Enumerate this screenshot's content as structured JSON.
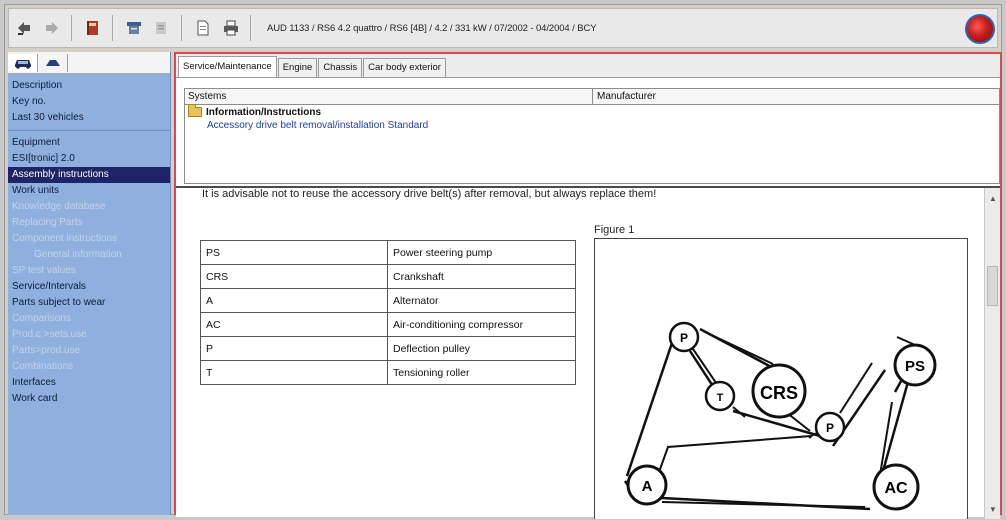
{
  "toolbar": {
    "vehicle_info": "AUD 1133 / RS6 4.2 quattro / RS6 [4B] / 4.2 / 331 kW / 07/2002 - 04/2004 / BCY",
    "icons": [
      "filter-icon",
      "forward-icon",
      "book-icon",
      "print-preview-icon",
      "zoom-icon",
      "document-icon",
      "printer-icon"
    ]
  },
  "sidebar": {
    "tab_icons": [
      "car-icon",
      "car-part-icon"
    ],
    "items": [
      {
        "label": "Description",
        "state": "normal"
      },
      {
        "label": "Key no.",
        "state": "normal"
      },
      {
        "label": "Last 30 vehicles",
        "state": "normal"
      },
      {
        "label": "Equipment",
        "state": "normal"
      },
      {
        "label": "ESI[tronic] 2.0",
        "state": "normal"
      },
      {
        "label": "Assembly instructions",
        "state": "selected"
      },
      {
        "label": "Work units",
        "state": "normal"
      },
      {
        "label": "Knowledge database",
        "state": "disabled"
      },
      {
        "label": "Replacing Parts",
        "state": "disabled"
      },
      {
        "label": "Component instructions",
        "state": "disabled"
      },
      {
        "label": "General information",
        "state": "disabled"
      },
      {
        "label": "SP test values",
        "state": "disabled"
      },
      {
        "label": "Service/Intervals",
        "state": "normal"
      },
      {
        "label": "Parts subject to wear",
        "state": "normal"
      },
      {
        "label": "Comparisons",
        "state": "disabled"
      },
      {
        "label": "Prod.c.>sets.use",
        "state": "disabled"
      },
      {
        "label": "Parts>prod.use",
        "state": "disabled"
      },
      {
        "label": "Combinations",
        "state": "disabled"
      },
      {
        "label": "Interfaces",
        "state": "normal"
      },
      {
        "label": "Work card",
        "state": "normal"
      }
    ]
  },
  "tabs": [
    "Service/Maintenance",
    "Engine",
    "Chassis",
    "Car body exterior"
  ],
  "systems": {
    "col_systems": "Systems",
    "col_manufacturer": "Manufacturer",
    "group": "Information/Instructions",
    "link": "Accessory drive belt removal/installation Standard"
  },
  "content": {
    "advice": "It is advisable not to reuse the accessory drive belt(s) after removal, but always replace them!",
    "legend": [
      {
        "abbr": "PS",
        "desc": "Power steering pump"
      },
      {
        "abbr": "CRS",
        "desc": "Crankshaft"
      },
      {
        "abbr": "A",
        "desc": "Alternator"
      },
      {
        "abbr": "AC",
        "desc": "Air-conditioning compressor"
      },
      {
        "abbr": "P",
        "desc": "Deflection pulley"
      },
      {
        "abbr": "T",
        "desc": "Tensioning roller"
      }
    ],
    "figure_title": "Figure 1",
    "pulleys": {
      "p1": "P",
      "t": "T",
      "crs": "CRS",
      "p2": "P",
      "ps": "PS",
      "a": "A",
      "ac": "AC"
    }
  },
  "colors": {
    "sidebar_bg": "#8fb0de",
    "selected_bg": "#1f2466",
    "link": "#1d3fa8",
    "active_border": "#d64b4b"
  }
}
